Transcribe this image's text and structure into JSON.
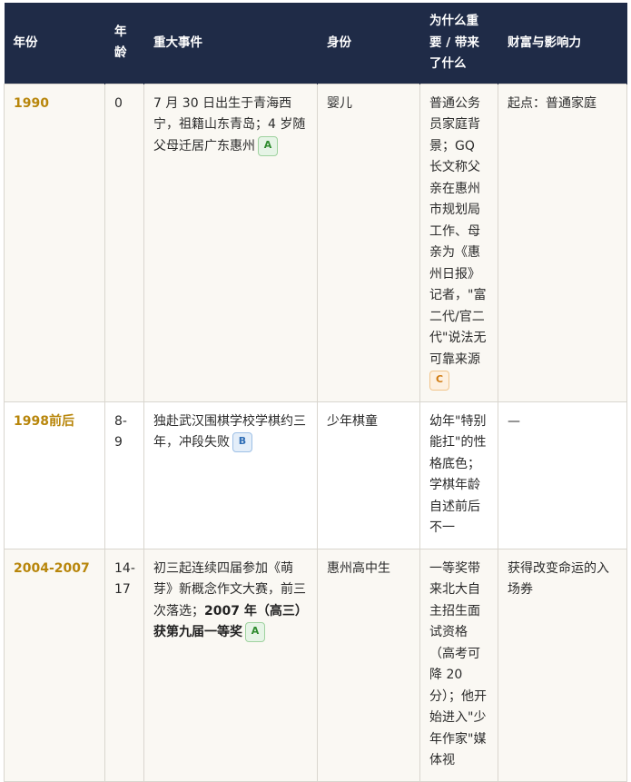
{
  "table": {
    "headers": [
      "年份",
      "年龄",
      "重大事件",
      "身份",
      "为什么重要 / 带来了什么",
      "财富与影响力"
    ],
    "rows": [
      {
        "year": "1990",
        "age": "0",
        "event": "7 月 30 日出生于青海西宁，祖籍山东青岛；4 岁随父母迁居广东惠州",
        "event_tag": "A",
        "identity": "婴儿",
        "why": "普通公务员家庭背景；GQ 长文称父亲在惠州市规划局工作、母亲为《惠州日报》记者，\"富二代/官二代\"说法无可靠来源",
        "why_tag": "C",
        "wealth": "起点：普通家庭"
      },
      {
        "year": "1998前后",
        "age": "8-9",
        "event": "独赴武汉围棋学校学棋约三年，冲段失败",
        "event_tag": "B",
        "identity": "少年棋童",
        "why": "幼年\"特别能扛\"的性格底色；学棋年龄自述前后不一",
        "wealth": "—"
      },
      {
        "year": "2004-2007",
        "age": "14-17",
        "event": "初三起连续四届参加《萌芽》新概念作文大赛，前三次落选；",
        "event_bold": "2007 年（高三）获第九届一等奖",
        "event_tag": "A",
        "identity": "惠州高中生",
        "why": "一等奖带来北大自主招生面试资格（高考可降 20 分）；他开始进入\"少年作家\"媒体视",
        "wealth": "获得改变命运的入场券"
      }
    ]
  }
}
